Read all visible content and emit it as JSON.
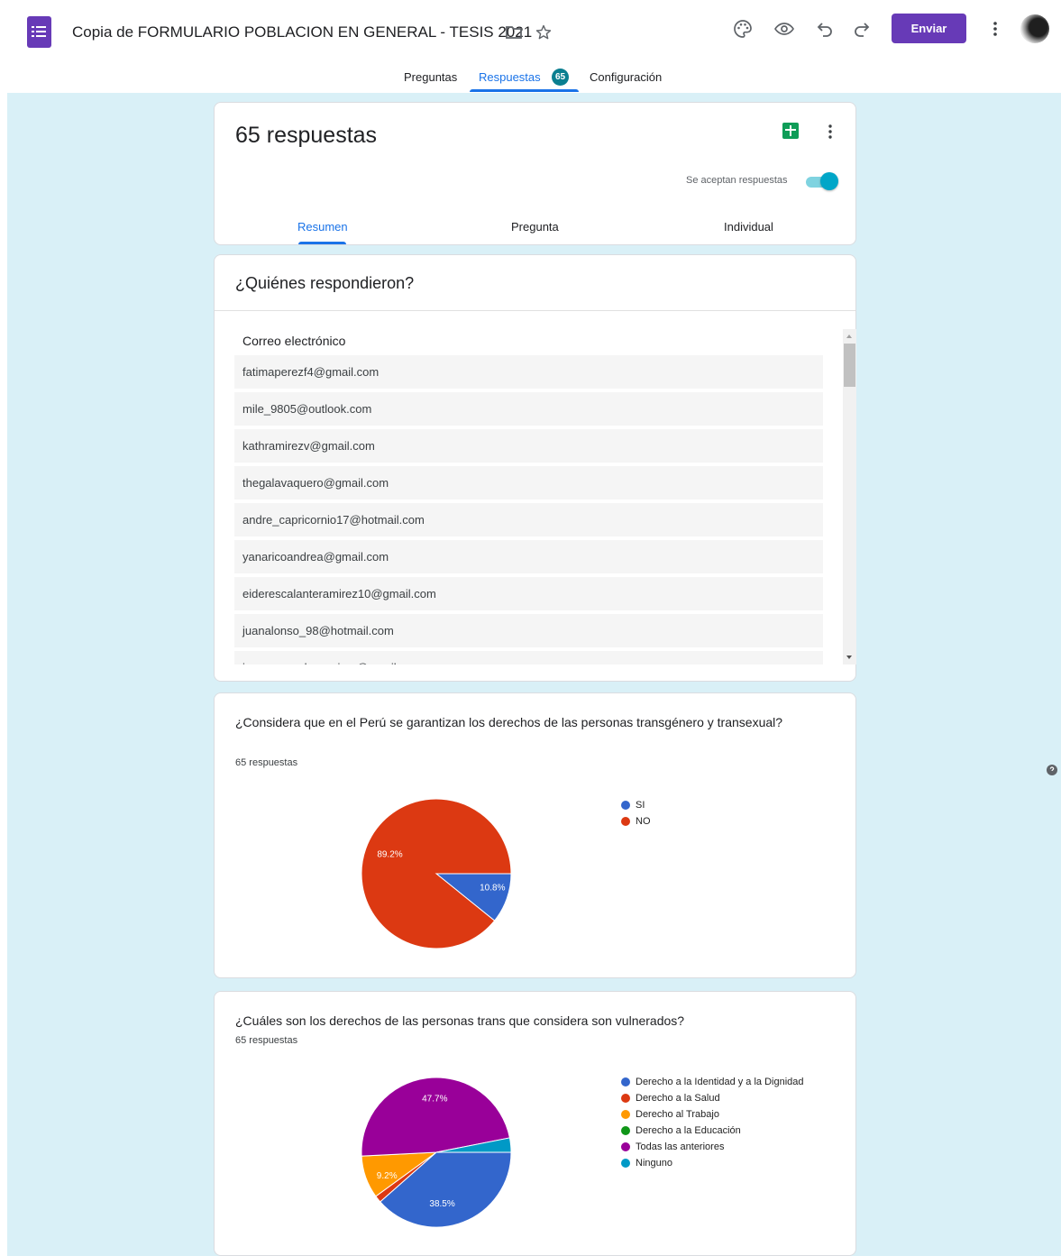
{
  "header": {
    "doc_title": "Copia de FORMULARIO POBLACION EN GENERAL - TESIS 2021",
    "send_label": "Enviar"
  },
  "tabs": {
    "questions": "Preguntas",
    "responses": "Respuestas",
    "responses_badge": "65",
    "settings": "Configuración"
  },
  "summary": {
    "count_label": "65 respuestas",
    "accepting_label": "Se aceptan respuestas",
    "accepting": true,
    "tabs": [
      "Resumen",
      "Pregunta",
      "Individual"
    ]
  },
  "who": {
    "title": "¿Quiénes respondieron?",
    "column": "Correo electrónico",
    "emails": [
      "fatimaperezf4@gmail.com",
      "mile_9805@outlook.com",
      "kathramirezv@gmail.com",
      "thegalavaquero@gmail.com",
      "andre_capricornio17@hotmail.com",
      "yanaricoandrea@gmail.com",
      "eiderescalanteramirez10@gmail.com",
      "juanalonso_98@hotmail.com",
      "jamespuccchoramirez@gmail.com"
    ]
  },
  "colors": {
    "purple": "#673ab7",
    "accent_blue": "#1a73e8",
    "badge_teal": "#0b7f90",
    "background": "#d9f0f7"
  },
  "chart_data": [
    {
      "type": "pie",
      "title": "¿Considera que en el Perú se garantizan los derechos de las personas transgénero y transexual?",
      "subtitle": "65 respuestas",
      "labels": [
        "SI",
        "NO"
      ],
      "values": [
        10.8,
        89.2
      ],
      "colors": [
        "#3366cc",
        "#dc3912"
      ],
      "data_labels": [
        "10.8%",
        "89.2%"
      ],
      "legend_position": "right"
    },
    {
      "type": "pie",
      "title": "¿Cuáles son los derechos de las personas trans que considera son vulnerados?",
      "subtitle": "65 respuestas",
      "labels": [
        "Derecho a la Identidad y a la Dignidad",
        "Derecho a la Salud",
        "Derecho al Trabajo",
        "Derecho a la Educación",
        "Todas las anteriores",
        "Ninguno"
      ],
      "values": [
        38.5,
        1.5,
        9.2,
        0,
        47.7,
        3.1
      ],
      "colors": [
        "#3366cc",
        "#dc3912",
        "#ff9900",
        "#109618",
        "#990099",
        "#0099c6"
      ],
      "data_labels": [
        "38.5%",
        "",
        "9.2%",
        "",
        "47.7%",
        ""
      ],
      "legend_position": "right"
    }
  ]
}
